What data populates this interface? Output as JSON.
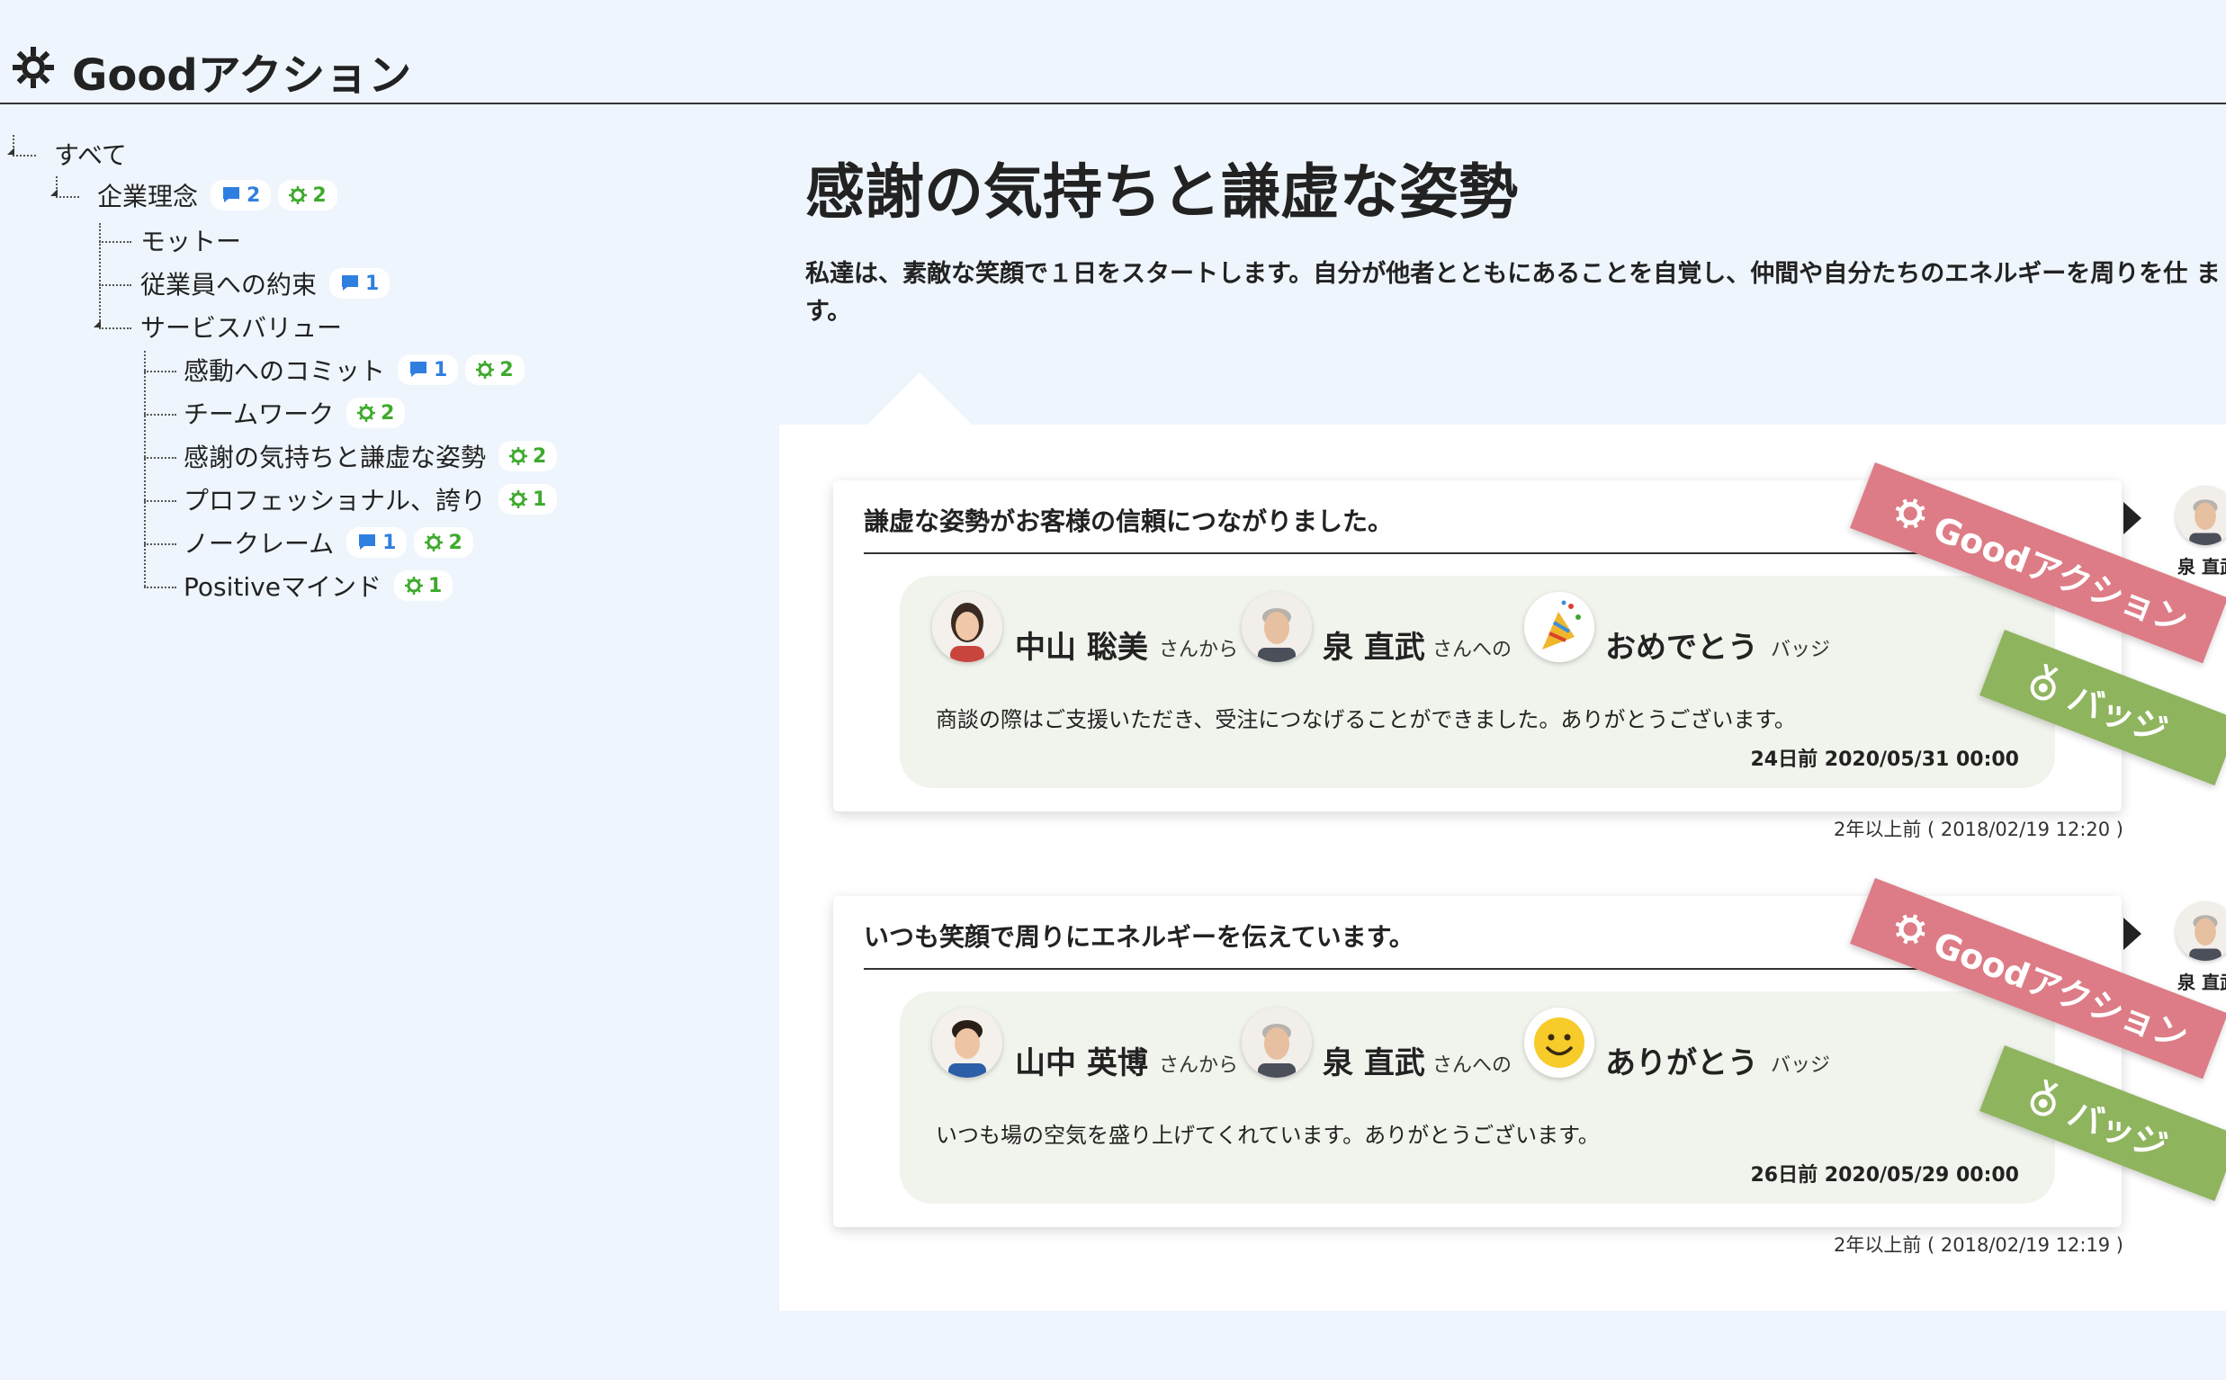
{
  "app": {
    "title": "Goodアクション",
    "icon": "gear-icon"
  },
  "tree": {
    "items": [
      {
        "label": "すべて",
        "comments": "",
        "goods": ""
      },
      {
        "label": "企業理念",
        "comments": "2",
        "goods": "2"
      },
      {
        "label": "モットー",
        "comments": "",
        "goods": ""
      },
      {
        "label": "従業員への約束",
        "comments": "1",
        "goods": ""
      },
      {
        "label": "サービスバリュー",
        "comments": "",
        "goods": ""
      },
      {
        "label": "感動へのコミット",
        "comments": "1",
        "goods": "2"
      },
      {
        "label": "チームワーク",
        "comments": "",
        "goods": "2"
      },
      {
        "label": "感謝の気持ちと謙虚な姿勢",
        "comments": "",
        "goods": "2"
      },
      {
        "label": "プロフェッショナル、誇り",
        "comments": "",
        "goods": "1"
      },
      {
        "label": "ノークレーム",
        "comments": "1",
        "goods": "2"
      },
      {
        "label": "Positiveマインド",
        "comments": "",
        "goods": "1"
      }
    ]
  },
  "main": {
    "title": "感謝の気持ちと謙虚な姿勢",
    "description": "私達は、素敵な笑顔で１日をスタートします。自分が他者とともにあることを自覚し、仲間や自分たちのエネルギーを周りを仕 ます。"
  },
  "cards": [
    {
      "title": "謙虚な姿勢がお客様の信頼につながりました。",
      "from_name": "中山 聡美",
      "from_suffix": "さんから",
      "to_name": "泉 直武",
      "to_suffix": "さんへの",
      "badge_name": "おめでとう",
      "badge_suffix": "バッジ",
      "badge_icon": "party-popper-icon",
      "message": "商談の際はご支援いただき、受注につなげることができました。ありがとうございます。",
      "stamp": "24日前 2020/05/31 00:00",
      "posted": "2年以上前 ( 2018/02/19 12:20 )",
      "ribbon_good": "Goodアクション",
      "ribbon_badge": "バッジ",
      "side_name": "泉 直武"
    },
    {
      "title": "いつも笑顔で周りにエネルギーを伝えています。",
      "from_name": "山中 英博",
      "from_suffix": "さんから",
      "to_name": "泉 直武",
      "to_suffix": "さんへの",
      "badge_name": "ありがとう",
      "badge_suffix": "バッジ",
      "badge_icon": "smiley-icon",
      "message": "いつも場の空気を盛り上げてくれています。ありがとうございます。",
      "stamp": "26日前 2020/05/29 00:00",
      "posted": "2年以上前 ( 2018/02/19 12:19 )",
      "ribbon_good": "Goodアクション",
      "ribbon_badge": "バッジ",
      "side_name": "泉 直武"
    }
  ],
  "colors": {
    "background": "#eef5fc",
    "comment_badge": "#2f7fe0",
    "good_badge": "#3faa2e",
    "ribbon_good": "#dd7c86",
    "ribbon_badge": "#8fb45e",
    "inner_card": "#f0f4ec"
  }
}
